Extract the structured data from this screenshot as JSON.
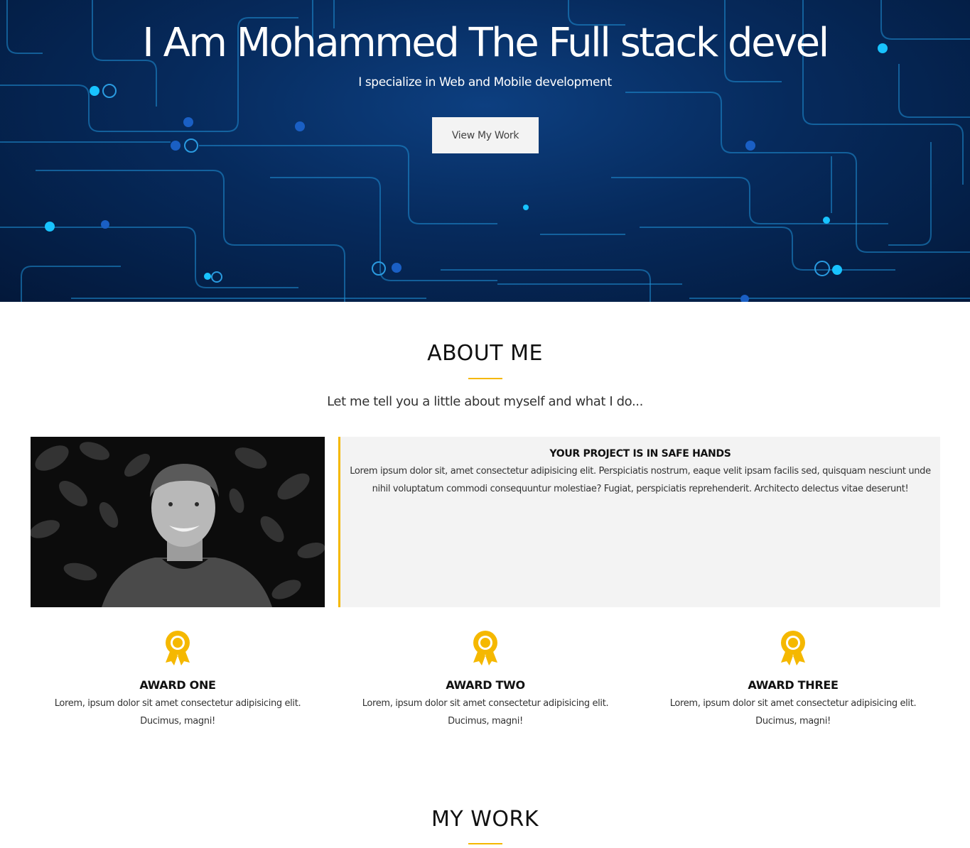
{
  "hero": {
    "title": "I Am Mohammed The Full stack devel",
    "subtitle": "I specialize in Web and Mobile development",
    "button_label": "View My Work"
  },
  "about": {
    "title": "ABOUT ME",
    "intro": "Let me tell you a little about myself and what I do...",
    "box_heading": "YOUR PROJECT IS IN SAFE HANDS",
    "box_text": "Lorem ipsum dolor sit, amet consectetur adipisicing elit. Perspiciatis nostrum, eaque velit ipsam facilis sed, quisquam nesciunt unde nihil voluptatum commodi consequuntur molestiae? Fugiat, perspiciatis reprehenderit. Architecto delectus vitae deserunt!"
  },
  "awards": [
    {
      "icon": "award-ribbon-icon",
      "title": "AWARD ONE",
      "text": "Lorem, ipsum dolor sit amet consectetur adipisicing elit. Ducimus, magni!"
    },
    {
      "icon": "award-ribbon-icon",
      "title": "AWARD TWO",
      "text": "Lorem, ipsum dolor sit amet consectetur adipisicing elit. Ducimus, magni!"
    },
    {
      "icon": "award-ribbon-icon",
      "title": "AWARD THREE",
      "text": "Lorem, ipsum dolor sit amet consectetur adipisicing elit. Ducimus, magni!"
    }
  ],
  "work": {
    "title": "MY WORK"
  },
  "colors": {
    "accent": "#f5b800",
    "hero_background": "#062a5c",
    "circuit_line": "#1fa6e6",
    "button_background": "#f3f3f3",
    "box_background": "#f3f3f3"
  }
}
